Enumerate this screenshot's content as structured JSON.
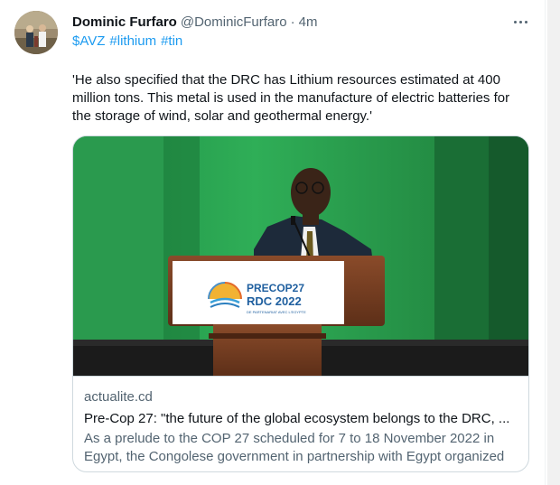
{
  "tweet": {
    "author_name": "Dominic Furfaro",
    "author_handle": "@DominicFurfaro",
    "separator": "·",
    "time": "4m",
    "hashtags": [
      "$AVZ",
      "#lithium",
      "#tin"
    ],
    "text": "'He also specified that the DRC has Lithium resources estimated at 400 million tons. This metal is used in the manufacture of electric batteries for the storage of wind, solar and geothermal energy.'"
  },
  "card": {
    "domain": "actualite.cd",
    "title": "Pre-Cop 27: \"the future of the global ecosystem belongs to the DRC, ...",
    "description": "As a prelude to the COP 27 scheduled for 7 to 18 November 2022 in Egypt, the Congolese government in partnership with Egypt organized ...",
    "image": {
      "logo_line1": "PRECOP27",
      "logo_line2": "RDC 2022",
      "logo_tagline": "DE PARTENARIAT AVEC L'EGYPTE"
    }
  },
  "icons": {
    "more": "more-options-icon"
  },
  "colors": {
    "link": "#1d9bf0",
    "secondary_text": "#536471",
    "primary_text": "#0f1419",
    "border": "#cfd9de"
  }
}
